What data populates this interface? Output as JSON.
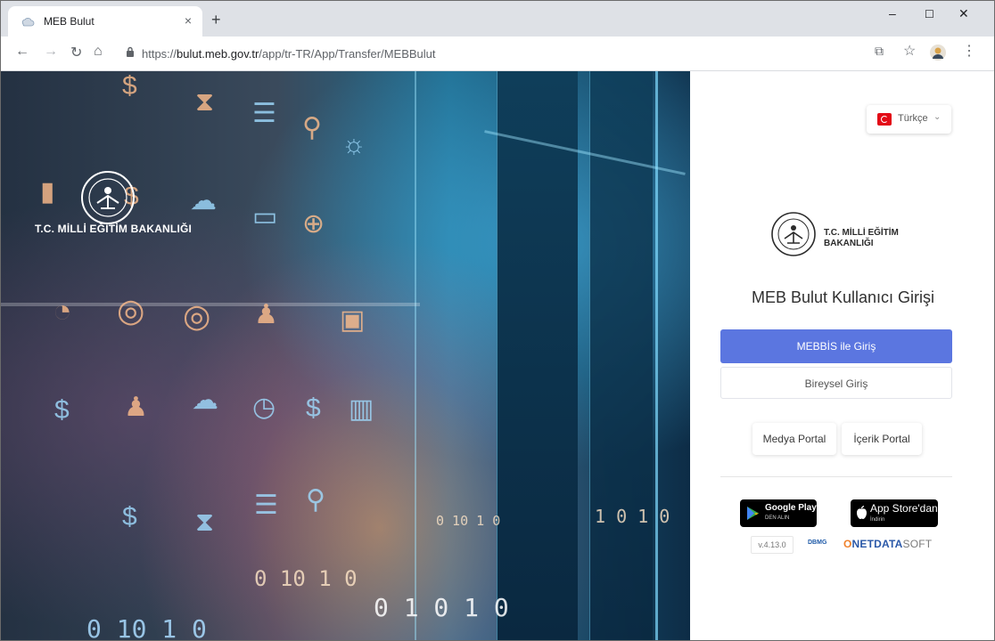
{
  "browser": {
    "tab_title": "MEB Bulut",
    "tab_close": "×",
    "new_tab": "+",
    "window_controls": {
      "minimize": "–",
      "maximize": "☐",
      "close": "✕"
    },
    "nav": {
      "back": "←",
      "forward": "→",
      "reload": "↻",
      "home": "⌂"
    },
    "url_scheme": "https://",
    "url_host": "bulut.meb.gov.tr",
    "url_path": "/app/tr-TR/App/Transfer/MEBBulut",
    "toolbar_icons": {
      "translate": "⧉",
      "star": "☆",
      "menu": "⋮"
    }
  },
  "hero": {
    "ministry_title": "T.C. MİLLİ EĞİTİM BAKANLIĞI",
    "digit_rows": [
      "0 10 1 0",
      "0  10  1  0",
      "0  1 0 1 0",
      "0 10 1 0",
      "1 0 1 0"
    ]
  },
  "panel": {
    "language": {
      "label": "Türkçe",
      "chevron": "⌄"
    },
    "logo_title": "T.C. MİLLİ EĞİTİM BAKANLIĞI",
    "heading": "MEB Bulut Kullanıcı Girişi",
    "primary_button": "MEBBİS ile Giriş",
    "secondary_button": "Bireysel Giriş",
    "portal_media": "Medya Portal",
    "portal_content": "İçerik Portal",
    "google_play": {
      "line1": "Google Play",
      "line2": "DEN ALIN"
    },
    "app_store": {
      "line1": "App Store'dan",
      "line2": "İndirin"
    },
    "version": "v.4.13.0",
    "mini_logo": "DBMG",
    "ndata": {
      "o": "O",
      "net": "NET",
      "data": "DATA",
      "soft": "SOFT"
    }
  },
  "colors": {
    "primary": "#5b76e0",
    "flag_red": "#e30a17",
    "brand_orange": "#f0812b"
  }
}
